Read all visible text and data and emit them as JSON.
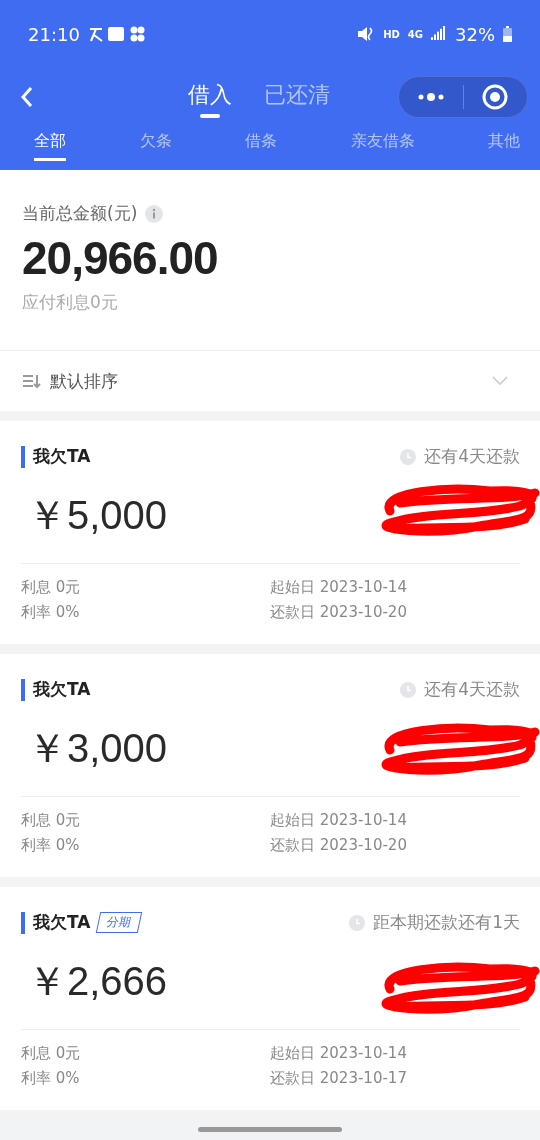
{
  "status_bar": {
    "time": "21:10",
    "network_labels": [
      "HD",
      "4G"
    ],
    "battery": "32%"
  },
  "nav": {
    "tabs": [
      {
        "label": "借入",
        "selected": true
      },
      {
        "label": "已还清",
        "selected": false
      }
    ]
  },
  "filters": [
    {
      "label": "全部",
      "selected": true
    },
    {
      "label": "欠条",
      "selected": false
    },
    {
      "label": "借条",
      "selected": false
    },
    {
      "label": "亲友借条",
      "selected": false
    },
    {
      "label": "其他",
      "selected": false
    }
  ],
  "summary": {
    "label": "当前总金额(元)",
    "amount": "20,966.00",
    "interest": "应付利息0元"
  },
  "sort": {
    "label": "默认排序"
  },
  "loans": [
    {
      "title": "我欠TA",
      "due": "还有4天还款",
      "amount": "￥5,000",
      "details": [
        "利息 0元",
        "起始日 2023-10-14",
        "利率 0%",
        "还款日 2023-10-20"
      ]
    },
    {
      "title": "我欠TA",
      "due": "还有4天还款",
      "amount": "￥3,000",
      "details": [
        "利息 0元",
        "起始日 2023-10-14",
        "利率 0%",
        "还款日 2023-10-20"
      ]
    },
    {
      "title": "我欠TA",
      "badge": "分期",
      "due": "距本期还款还有1天",
      "amount": "￥2,666",
      "details": [
        "利息 0元",
        "起始日 2023-10-14",
        "利率 0%",
        "还款日 2023-10-17"
      ]
    }
  ]
}
